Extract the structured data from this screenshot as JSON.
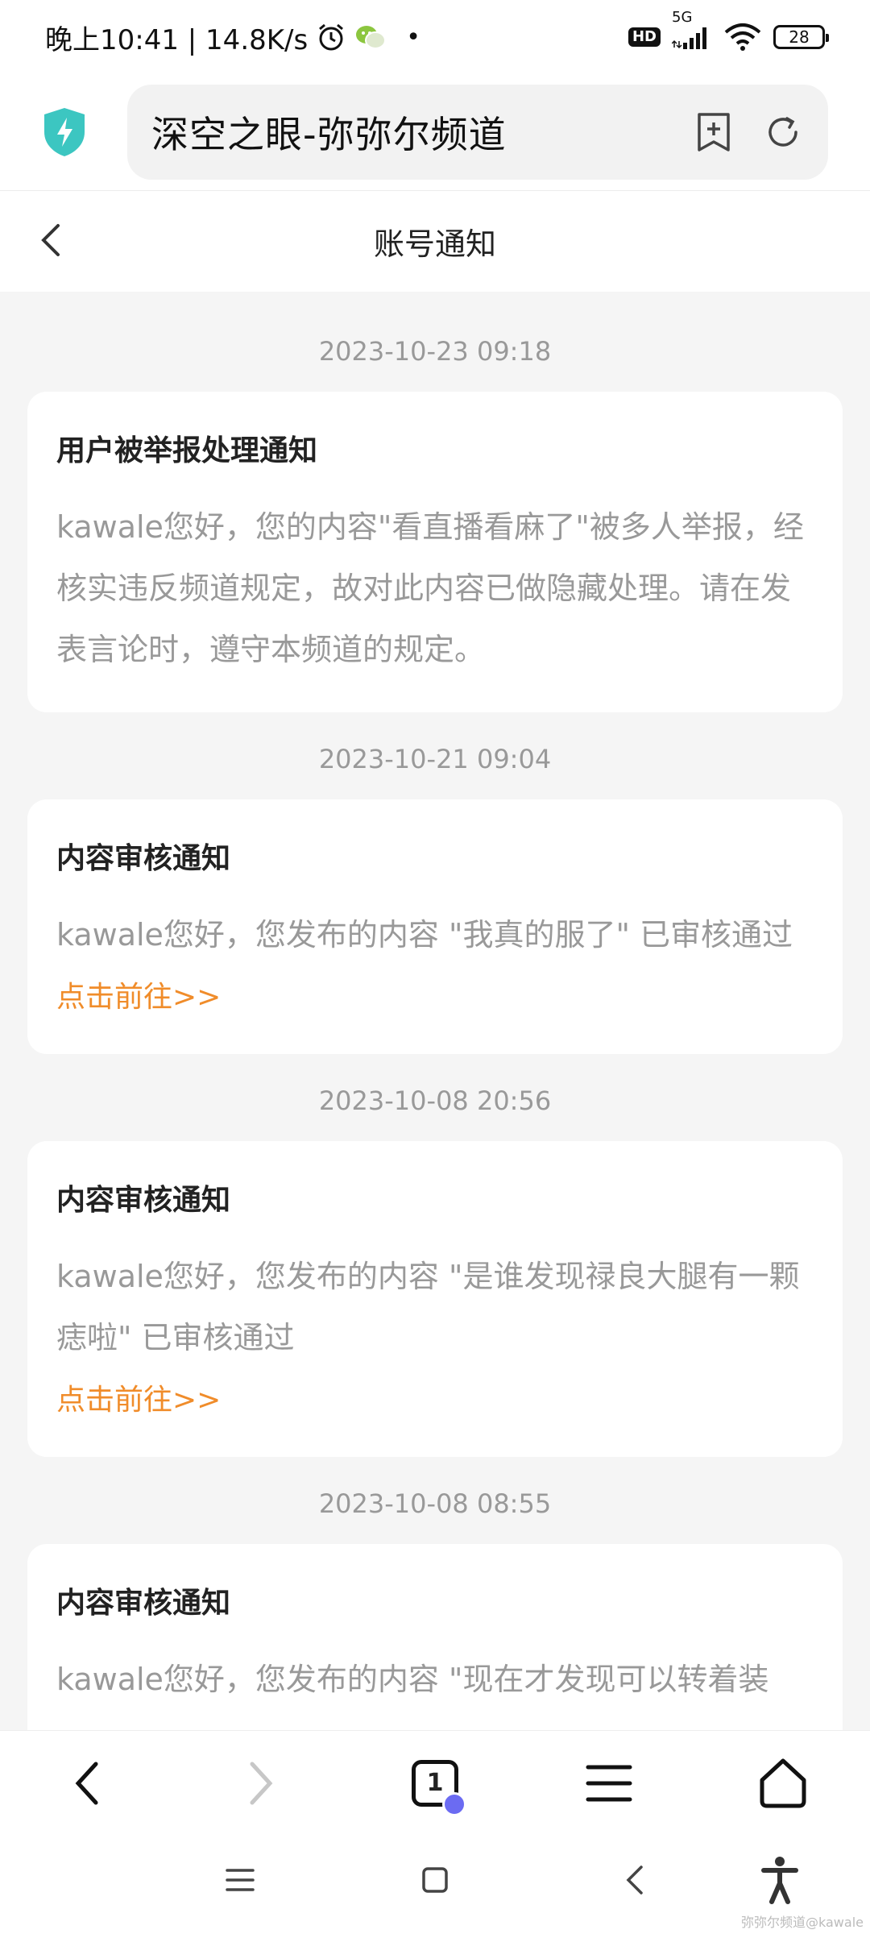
{
  "status_bar": {
    "time_speed": "晚上10:41 | 14.8K/s",
    "network": "5G",
    "hd": "HD",
    "battery": "28"
  },
  "browser": {
    "url_title": "深空之眼-弥弥尔频道"
  },
  "header": {
    "title": "账号通知"
  },
  "notifications": [
    {
      "time": "2023-10-23 09:18",
      "title": "用户被举报处理通知",
      "body": "kawale您好，您的内容\"看直播看麻了\"被多人举报，经核实违反频道规定，故对此内容已做隐藏处理。请在发表言论时，遵守本频道的规定。",
      "link": ""
    },
    {
      "time": "2023-10-21 09:04",
      "title": "内容审核通知",
      "body": "kawale您好，您发布的内容 \"我真的服了\" 已审核通过",
      "link": "点击前往>>"
    },
    {
      "time": "2023-10-08 20:56",
      "title": "内容审核通知",
      "body": "kawale您好，您发布的内容 \"是谁发现禄良大腿有一颗痣啦\" 已审核通过",
      "link": "点击前往>>"
    },
    {
      "time": "2023-10-08 08:55",
      "title": "内容审核通知",
      "body": "kawale您好，您发布的内容 \"现在才发现可以转着装",
      "link": ""
    }
  ],
  "bottom_nav": {
    "tab_count": "1"
  },
  "watermark": "弥弥尔频道@kawale",
  "colors": {
    "accent_link": "#f08c2a",
    "shield": "#3cc6c1",
    "background": "#f5f5f5"
  }
}
